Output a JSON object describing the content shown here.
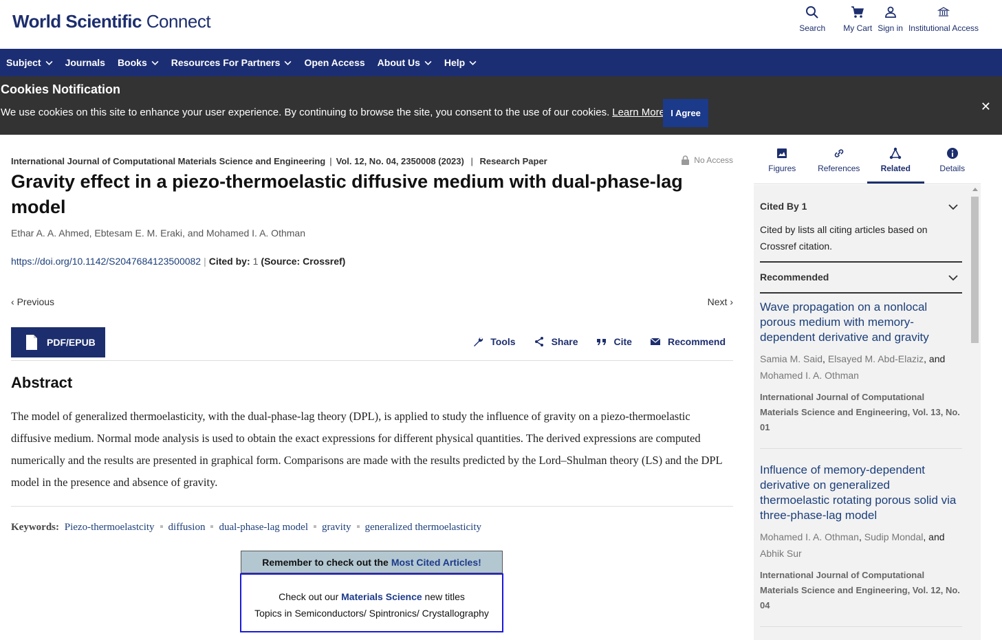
{
  "header": {
    "logo_bold": "World Scientific",
    "logo_light": "Connect",
    "actions": [
      {
        "label": "Search",
        "icon": "search-icon"
      },
      {
        "label": "My Cart",
        "icon": "cart-icon"
      },
      {
        "label": "Sign in",
        "icon": "user-icon"
      },
      {
        "label": "Institutional Access",
        "icon": "institution-icon"
      }
    ]
  },
  "nav": {
    "items": [
      {
        "label": "Subject",
        "dropdown": true
      },
      {
        "label": "Journals",
        "dropdown": false
      },
      {
        "label": "Books",
        "dropdown": true
      },
      {
        "label": "Resources For Partners",
        "dropdown": true
      },
      {
        "label": "Open Access",
        "dropdown": false
      },
      {
        "label": "About Us",
        "dropdown": true
      },
      {
        "label": "Help",
        "dropdown": true
      }
    ]
  },
  "cookie": {
    "title": "Cookies Notification",
    "text": "We use cookies on this site to enhance your user experience. By continuing to browse the site, you consent to the use of our cookies.",
    "learn_more": "Learn More",
    "agree": "I Agree",
    "close": "✕"
  },
  "article": {
    "journal": "International Journal of Computational Materials Science and Engineering",
    "volume": "Vol. 12, No. 04, 2350008 (2023)",
    "type": "Research Paper",
    "access": "No Access",
    "title": "Gravity effect in a piezo-thermoelastic diffusive medium with dual-phase-lag model",
    "authors": "Ethar A. A. Ahmed, Ebtesam E. M. Eraki, and Mohamed I. A. Othman",
    "doi": "https://doi.org/10.1142/S2047684123500082",
    "cited_by_label": "Cited by:",
    "cited_by_count": "1",
    "cited_by_source": "(Source: Crossref)",
    "previous": "Previous",
    "next": "Next",
    "pdf_label": "PDF/EPUB",
    "tools": [
      {
        "label": "Tools",
        "icon": "wrench-icon"
      },
      {
        "label": "Share",
        "icon": "share-icon"
      },
      {
        "label": "Cite",
        "icon": "quote-icon"
      },
      {
        "label": "Recommend",
        "icon": "envelope-icon"
      }
    ],
    "abstract_heading": "Abstract",
    "abstract": "The model of generalized thermoelasticity, with the dual-phase-lag theory (DPL), is applied to study the influence of gravity on a piezo-thermoelastic diffusive medium. Normal mode analysis is used to obtain the exact expressions for different physical quantities. The derived expressions are computed numerically and the results are presented in graphical form. Comparisons are made with the results predicted by the Lord–Shulman theory (LS) and the DPL model in the presence and absence of gravity.",
    "keywords_label": "Keywords:",
    "keywords": [
      "Piezo-thermoelastcity",
      "diffusion",
      "dual-phase-lag model",
      "gravity",
      "generalized thermoelasticity"
    ]
  },
  "promo": {
    "line1_prefix": "Remember to check out the",
    "line1_link": "Most Cited Articles!",
    "line2_prefix": "Check out our",
    "line2_link": "Materials Science",
    "line2_suffix": "new titles",
    "line3": "Topics in Semiconductors/ Spintronics/ Crystallography"
  },
  "sidebar": {
    "tabs": [
      {
        "label": "Figures",
        "icon": "image-icon",
        "active": false
      },
      {
        "label": "References",
        "icon": "link-icon",
        "active": false
      },
      {
        "label": "Related",
        "icon": "network-icon",
        "active": true
      },
      {
        "label": "Details",
        "icon": "info-icon",
        "active": false
      }
    ],
    "cited_by_heading": "Cited By 1",
    "cited_by_text": "Cited by lists all citing articles based on Crossref citation.",
    "recommended_heading": "Recommended",
    "recommended": [
      {
        "title": "Wave propagation on a nonlocal porous medium with memory-dependent derivative and gravity",
        "authors": [
          "Samia M. Said",
          "Elsayed M. Abd-Elaziz",
          "Mohamed I. A. Othman"
        ],
        "journal": "International Journal of Computational Materials Science and Engineering, Vol. 13, No. 01"
      },
      {
        "title": "Influence of memory-dependent derivative on generalized thermoelastic rotating porous solid via three-phase-lag model",
        "authors": [
          "Mohamed I. A. Othman",
          "Sudip Mondal",
          "Abhik Sur"
        ],
        "journal": "International Journal of Computational Materials Science and Engineering, Vol. 12, No. 04"
      }
    ]
  }
}
